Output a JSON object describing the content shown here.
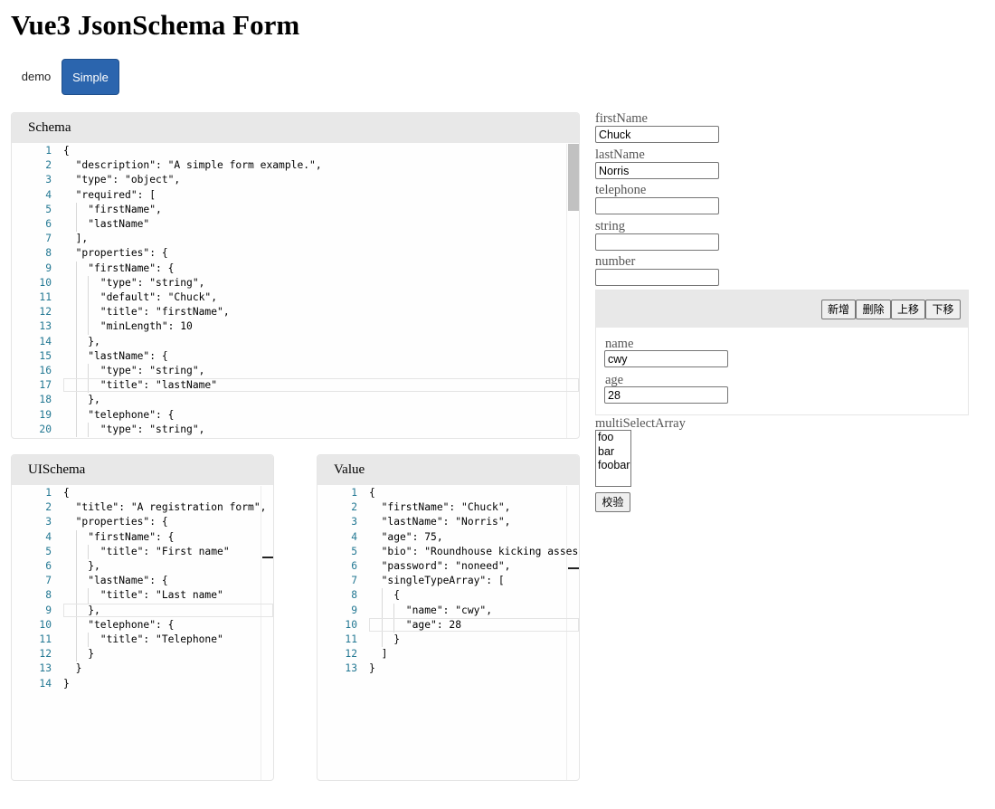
{
  "page": {
    "title": "Vue3 JsonSchema Form"
  },
  "tabs": [
    {
      "label": "demo"
    },
    {
      "label": "Simple"
    }
  ],
  "schema_panel": {
    "title": "Schema",
    "lines": [
      "{",
      "  \"description\": \"A simple form example.\",",
      "  \"type\": \"object\",",
      "  \"required\": [",
      "    \"firstName\",",
      "    \"lastName\"",
      "  ],",
      "  \"properties\": {",
      "    \"firstName\": {",
      "      \"type\": \"string\",",
      "      \"default\": \"Chuck\",",
      "      \"title\": \"firstName\",",
      "      \"minLength\": 10",
      "    },",
      "    \"lastName\": {",
      "      \"type\": \"string\",",
      "      \"title\": \"lastName\"",
      "    },",
      "    \"telephone\": {",
      "      \"type\": \"string\","
    ]
  },
  "uischema_panel": {
    "title": "UISchema",
    "lines": [
      "{",
      "  \"title\": \"A registration form\",",
      "  \"properties\": {",
      "    \"firstName\": {",
      "      \"title\": \"First name\"",
      "    },",
      "    \"lastName\": {",
      "      \"title\": \"Last name\"",
      "    },",
      "    \"telephone\": {",
      "      \"title\": \"Telephone\"",
      "    }",
      "  }",
      "}"
    ]
  },
  "value_panel": {
    "title": "Value",
    "lines": [
      "{",
      "  \"firstName\": \"Chuck\",",
      "  \"lastName\": \"Norris\",",
      "  \"age\": 75,",
      "  \"bio\": \"Roundhouse kicking asses s",
      "  \"password\": \"noneed\",",
      "  \"singleTypeArray\": [",
      "    {",
      "      \"name\": \"cwy\",",
      "      \"age\": 28",
      "    }",
      "  ]",
      "}"
    ]
  },
  "form": {
    "firstName": {
      "label": "firstName",
      "value": "Chuck"
    },
    "lastName": {
      "label": "lastName",
      "value": "Norris"
    },
    "telephone": {
      "label": "telephone",
      "value": ""
    },
    "string": {
      "label": "string",
      "value": ""
    },
    "number": {
      "label": "number",
      "value": ""
    },
    "array_buttons": {
      "add": "新增",
      "delete": "删除",
      "up": "上移",
      "down": "下移"
    },
    "array_item": {
      "name": {
        "label": "name",
        "value": "cwy"
      },
      "age": {
        "label": "age",
        "value": "28"
      }
    },
    "multiSelectArray": {
      "label": "multiSelectArray",
      "options": [
        "foo",
        "bar",
        "foobar"
      ]
    },
    "validate_label": "校验"
  }
}
